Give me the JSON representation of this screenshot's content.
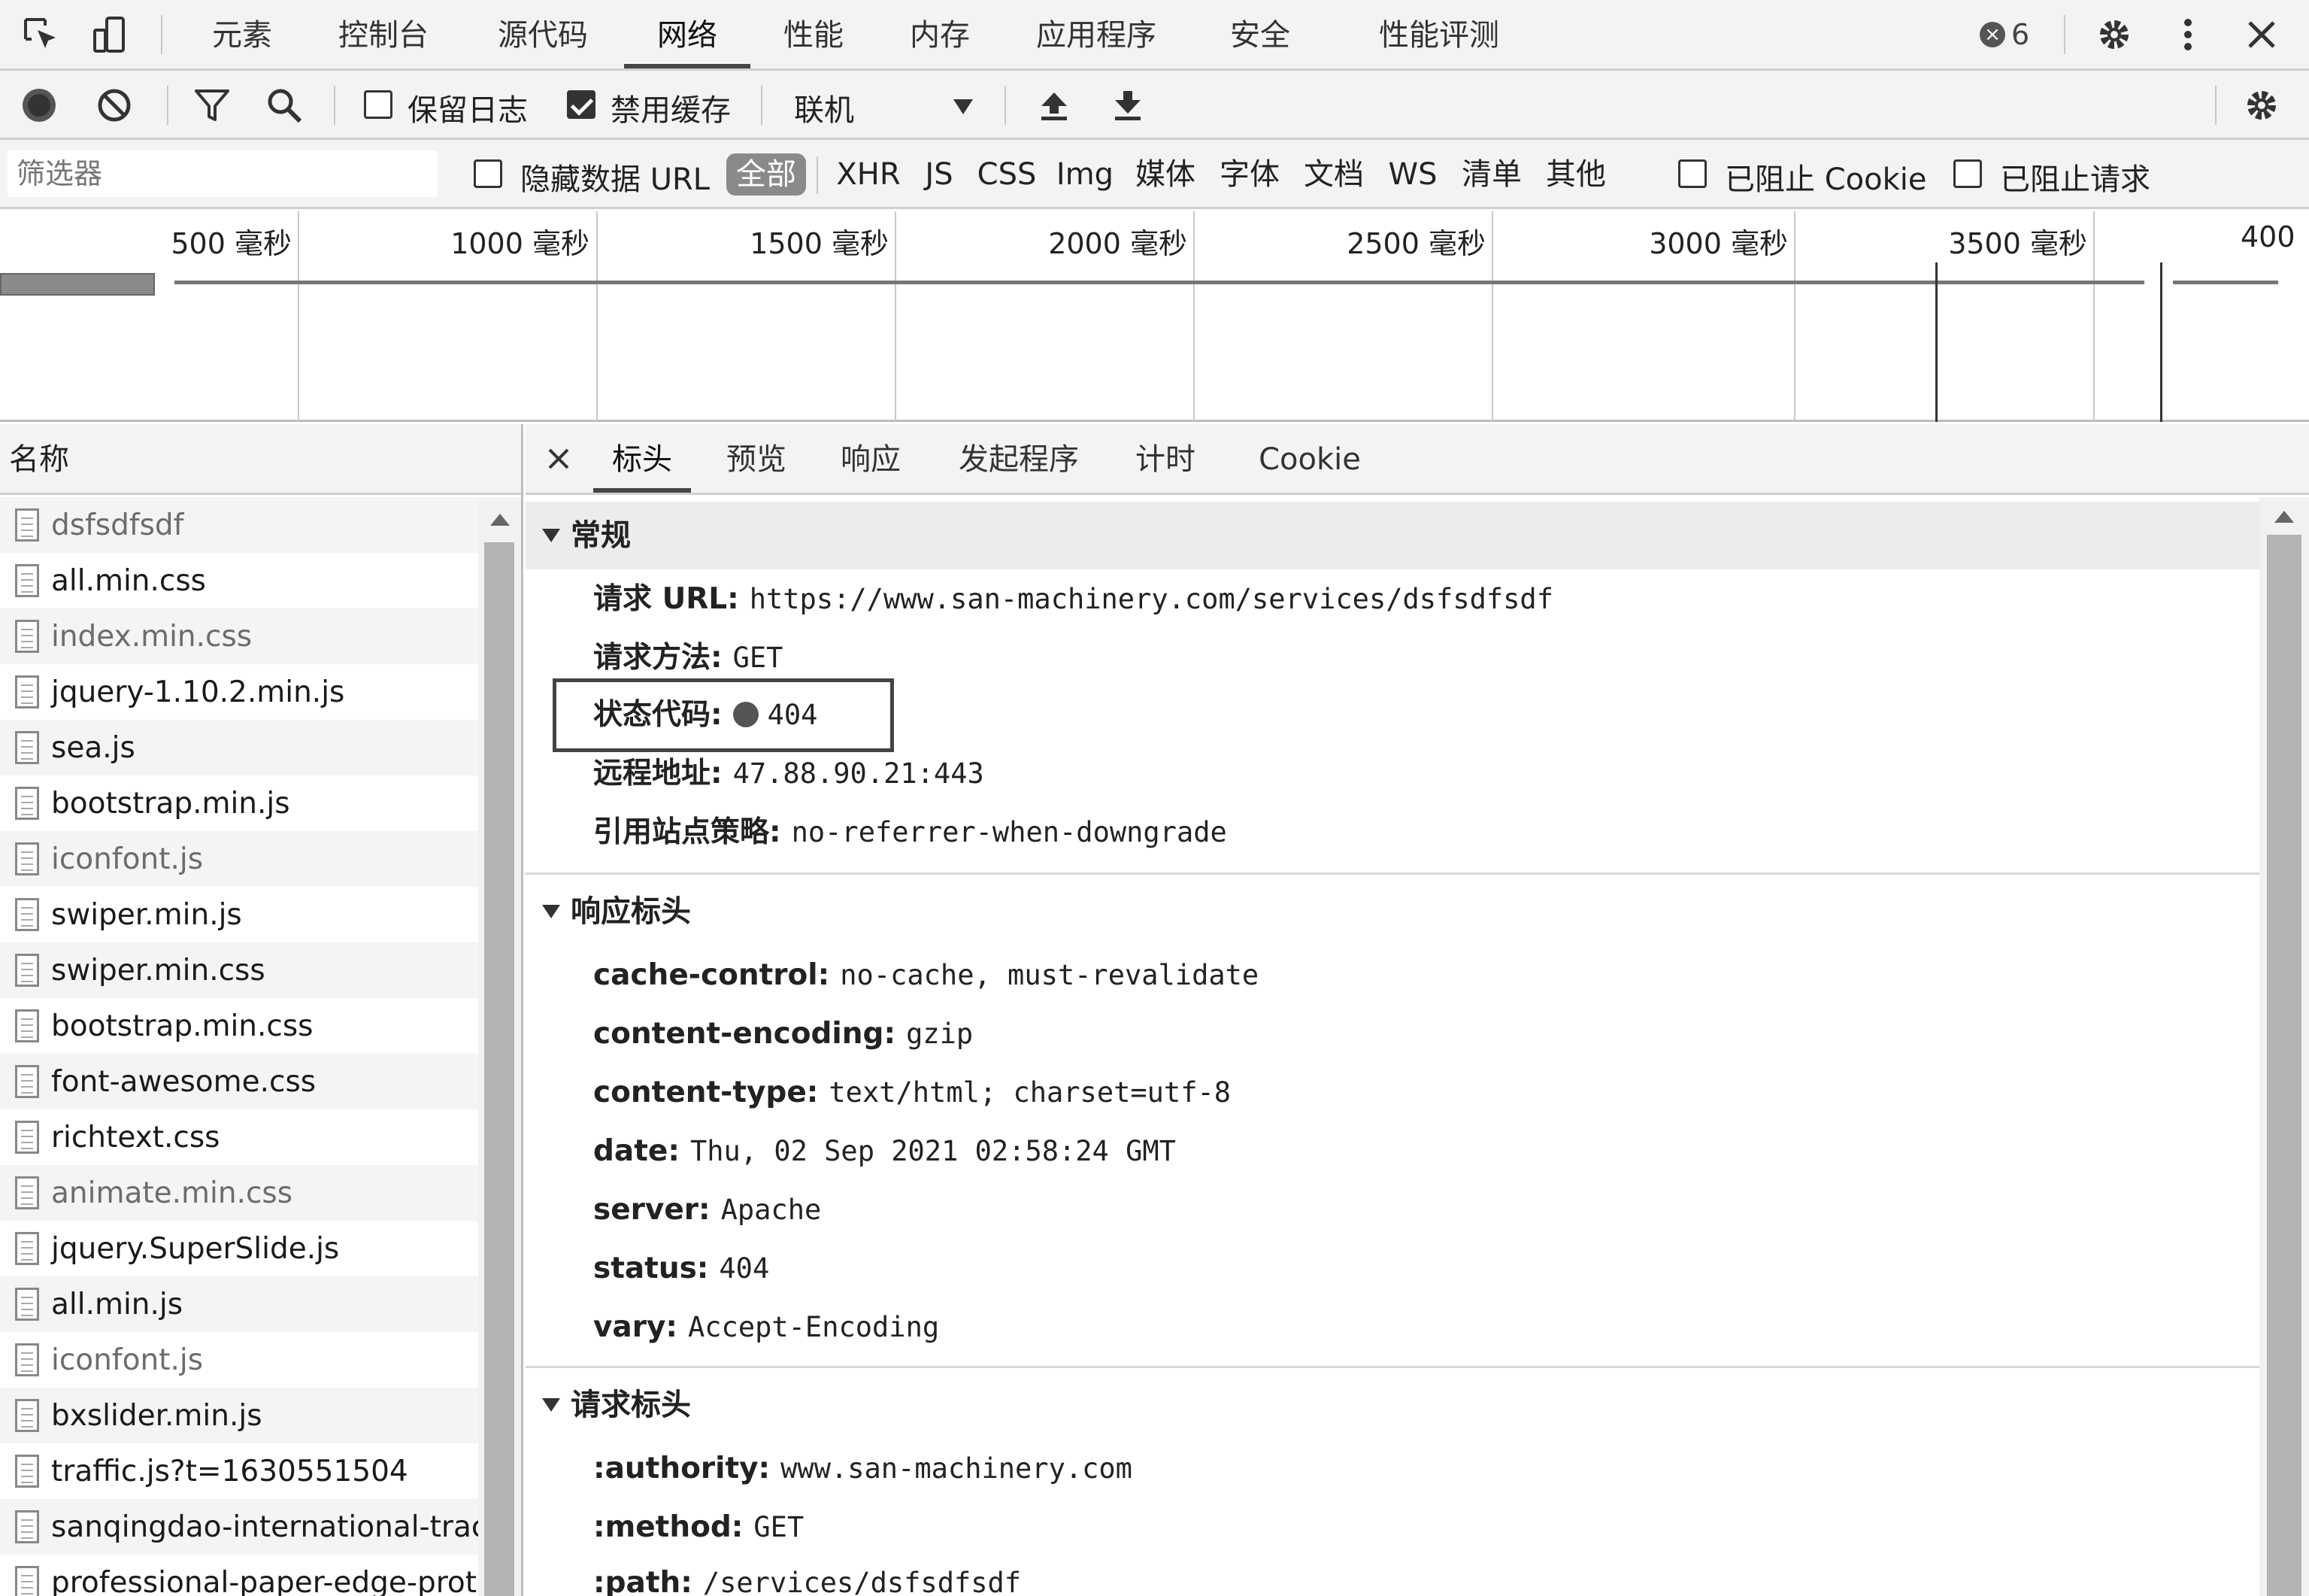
{
  "topbar": {
    "tabs": [
      "元素",
      "控制台",
      "源代码",
      "网络",
      "性能",
      "内存",
      "应用程序",
      "安全",
      "性能评测"
    ],
    "active_tab": "网络",
    "error_count": "6"
  },
  "toolbar": {
    "preserve_log_label": "保留日志",
    "preserve_log_checked": false,
    "disable_cache_label": "禁用缓存",
    "disable_cache_checked": true,
    "throttle_value": "联机"
  },
  "filter": {
    "placeholder": "筛选器",
    "hide_data_url_label": "隐藏数据 URL",
    "types": [
      "全部",
      "XHR",
      "JS",
      "CSS",
      "Img",
      "媒体",
      "字体",
      "文档",
      "WS",
      "清单",
      "其他"
    ],
    "active_type": "全部",
    "blocked_cookies_label": "已阻止 Cookie",
    "blocked_requests_label": "已阻止请求"
  },
  "overview": {
    "ticks": [
      "500 毫秒",
      "1000 毫秒",
      "1500 毫秒",
      "2000 毫秒",
      "2500 毫秒",
      "3000 毫秒",
      "3500 毫秒",
      "400"
    ]
  },
  "request_list": {
    "column_header": "名称",
    "rows": [
      {
        "name": "dsfsdfsdf",
        "dim": true
      },
      {
        "name": "all.min.css",
        "dim": false
      },
      {
        "name": "index.min.css",
        "dim": true
      },
      {
        "name": "jquery-1.10.2.min.js",
        "dim": false
      },
      {
        "name": "sea.js",
        "dim": false
      },
      {
        "name": "bootstrap.min.js",
        "dim": false
      },
      {
        "name": "iconfont.js",
        "dim": true
      },
      {
        "name": "swiper.min.js",
        "dim": false
      },
      {
        "name": "swiper.min.css",
        "dim": false
      },
      {
        "name": "bootstrap.min.css",
        "dim": false
      },
      {
        "name": "font-awesome.css",
        "dim": false
      },
      {
        "name": "richtext.css",
        "dim": false
      },
      {
        "name": "animate.min.css",
        "dim": true
      },
      {
        "name": "jquery.SuperSlide.js",
        "dim": false
      },
      {
        "name": "all.min.js",
        "dim": false
      },
      {
        "name": "iconfont.js",
        "dim": true
      },
      {
        "name": "bxslider.min.js",
        "dim": false
      },
      {
        "name": "traffic.js?t=1630551504",
        "dim": false
      },
      {
        "name": "sanqingdao-international-trac",
        "dim": false
      },
      {
        "name": "professional-paper-edge-prot",
        "dim": false
      }
    ]
  },
  "detail": {
    "tabs": [
      "标头",
      "预览",
      "响应",
      "发起程序",
      "计时",
      "Cookie"
    ],
    "active_tab": "标头",
    "general": {
      "title": "常规",
      "rows": [
        {
          "k": "请求 URL:",
          "v": "https://www.san-machinery.com/services/dsfsdfsdf"
        },
        {
          "k": "请求方法:",
          "v": "GET"
        },
        {
          "k": "状态代码:",
          "v": "404"
        },
        {
          "k": "远程地址:",
          "v": "47.88.90.21:443"
        },
        {
          "k": "引用站点策略:",
          "v": "no-referrer-when-downgrade"
        }
      ]
    },
    "response_headers": {
      "title": "响应标头",
      "rows": [
        {
          "k": "cache-control:",
          "v": "no-cache, must-revalidate"
        },
        {
          "k": "content-encoding:",
          "v": "gzip"
        },
        {
          "k": "content-type:",
          "v": "text/html; charset=utf-8"
        },
        {
          "k": "date:",
          "v": "Thu, 02 Sep 2021 02:58:24 GMT"
        },
        {
          "k": "server:",
          "v": "Apache"
        },
        {
          "k": "status:",
          "v": "404"
        },
        {
          "k": "vary:",
          "v": "Accept-Encoding"
        }
      ]
    },
    "request_headers": {
      "title": "请求标头",
      "rows": [
        {
          "k": ":authority:",
          "v": "www.san-machinery.com"
        },
        {
          "k": ":method:",
          "v": "GET"
        },
        {
          "k": ":path:",
          "v": "/services/dsfsdfsdf"
        }
      ]
    }
  },
  "icons": {
    "inspect": "inspect-element-icon",
    "device": "device-toolbar-icon",
    "record": "record-icon",
    "clear": "clear-icon",
    "filter": "filter-icon",
    "search": "search-icon",
    "upload": "upload-icon",
    "download": "download-icon",
    "settings": "gear-icon",
    "menu": "kebab-menu-icon",
    "close": "close-icon"
  }
}
